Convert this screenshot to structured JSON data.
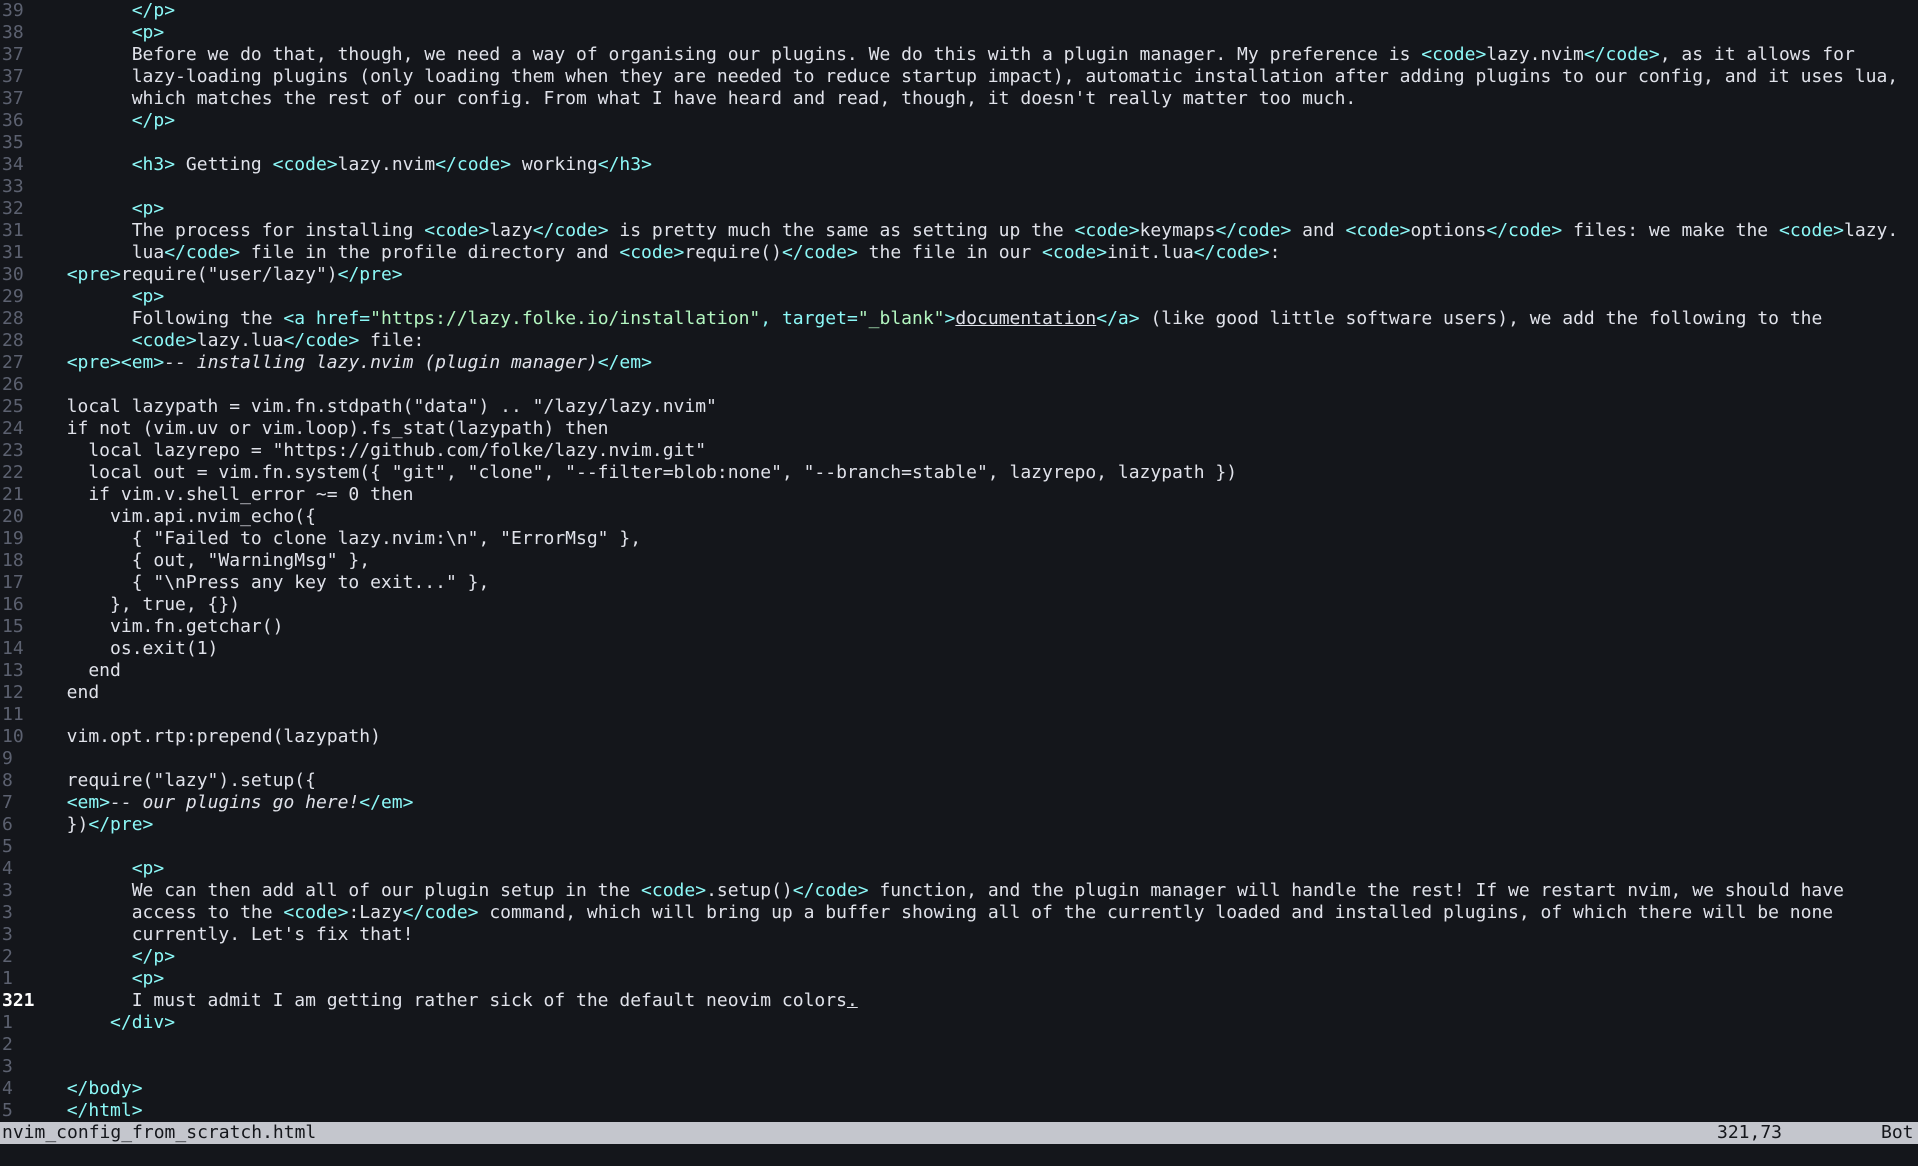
{
  "statusline": {
    "filename": "nvim_config_from_scratch.html",
    "position": "321,73",
    "scroll": "Bot"
  },
  "colors": {
    "background": "#14161b",
    "text": "#e0e2ea",
    "tag": "#8cf8f7",
    "string": "#b3f6c0",
    "line_number": "#5c6170",
    "statusline_bg": "#c4c6cd"
  },
  "lines": [
    {
      "num": "39",
      "segs": [
        [
          "",
          "        "
        ],
        [
          "tag",
          "</p>"
        ]
      ]
    },
    {
      "num": "38",
      "segs": [
        [
          "",
          "        "
        ],
        [
          "tag",
          "<p>"
        ]
      ]
    },
    {
      "num": "37",
      "segs": [
        [
          "",
          "        Before we do that, though, we need a way of organising our plugins. We do this with a plugin manager. My preference is "
        ],
        [
          "tag",
          "<code>"
        ],
        [
          "",
          "lazy.nvim"
        ],
        [
          "tag",
          "</code>"
        ],
        [
          "",
          ", as it allows for"
        ]
      ]
    },
    {
      "num": "37",
      "segs": [
        [
          "",
          "        lazy-loading plugins (only loading them when they are needed to reduce startup impact), automatic installation after adding plugins to our config, and it uses lua,"
        ]
      ]
    },
    {
      "num": "37",
      "segs": [
        [
          "",
          "        which matches the rest of our config. From what I have heard and read, though, it doesn't really matter too much."
        ]
      ]
    },
    {
      "num": "36",
      "segs": [
        [
          "",
          "        "
        ],
        [
          "tag",
          "</p>"
        ]
      ]
    },
    {
      "num": "35",
      "segs": []
    },
    {
      "num": "34",
      "segs": [
        [
          "",
          "        "
        ],
        [
          "tag",
          "<h3>"
        ],
        [
          "",
          " Getting "
        ],
        [
          "tag",
          "<code>"
        ],
        [
          "",
          "lazy.nvim"
        ],
        [
          "tag",
          "</code>"
        ],
        [
          "",
          " working"
        ],
        [
          "tag",
          "</h3>"
        ]
      ]
    },
    {
      "num": "33",
      "segs": []
    },
    {
      "num": "32",
      "segs": [
        [
          "",
          "        "
        ],
        [
          "tag",
          "<p>"
        ]
      ]
    },
    {
      "num": "31",
      "segs": [
        [
          "",
          "        The process for installing "
        ],
        [
          "tag",
          "<code>"
        ],
        [
          "",
          "lazy"
        ],
        [
          "tag",
          "</code>"
        ],
        [
          "",
          " is pretty much the same as setting up the "
        ],
        [
          "tag",
          "<code>"
        ],
        [
          "",
          "keymaps"
        ],
        [
          "tag",
          "</code>"
        ],
        [
          "",
          " and "
        ],
        [
          "tag",
          "<code>"
        ],
        [
          "",
          "options"
        ],
        [
          "tag",
          "</code>"
        ],
        [
          "",
          " files: we make the "
        ],
        [
          "tag",
          "<code>"
        ],
        [
          "",
          "lazy."
        ]
      ]
    },
    {
      "num": "31",
      "segs": [
        [
          "",
          "        lua"
        ],
        [
          "tag",
          "</code>"
        ],
        [
          "",
          " file in the profile directory and "
        ],
        [
          "tag",
          "<code>"
        ],
        [
          "",
          "require()"
        ],
        [
          "tag",
          "</code>"
        ],
        [
          "",
          " the file in our "
        ],
        [
          "tag",
          "<code>"
        ],
        [
          "",
          "init.lua"
        ],
        [
          "tag",
          "</code>"
        ],
        [
          "",
          ":"
        ]
      ]
    },
    {
      "num": "30",
      "segs": [
        [
          "",
          "  "
        ],
        [
          "tag",
          "<pre>"
        ],
        [
          "",
          "require(\"user/lazy\")"
        ],
        [
          "tag",
          "</pre>"
        ]
      ]
    },
    {
      "num": "29",
      "segs": [
        [
          "",
          "        "
        ],
        [
          "tag",
          "<p>"
        ]
      ]
    },
    {
      "num": "28",
      "segs": [
        [
          "",
          "        Following the "
        ],
        [
          "tag",
          "<a href="
        ],
        [
          "str",
          "\"https://lazy.folke.io/installation\""
        ],
        [
          "tag",
          ", target="
        ],
        [
          "str",
          "\"_blank\""
        ],
        [
          "tag",
          ">"
        ],
        [
          "u",
          "documentation"
        ],
        [
          "tag",
          "</a>"
        ],
        [
          "",
          " (like good little software users), we add the following to the"
        ]
      ]
    },
    {
      "num": "28",
      "segs": [
        [
          "",
          "        "
        ],
        [
          "tag",
          "<code>"
        ],
        [
          "",
          "lazy.lua"
        ],
        [
          "tag",
          "</code>"
        ],
        [
          "",
          " file:"
        ]
      ]
    },
    {
      "num": "27",
      "segs": [
        [
          "",
          "  "
        ],
        [
          "tag",
          "<pre><em>"
        ],
        [
          "em",
          "-- installing lazy.nvim (plugin manager)"
        ],
        [
          "tag",
          "</em>"
        ]
      ]
    },
    {
      "num": "26",
      "segs": []
    },
    {
      "num": "25",
      "segs": [
        [
          "",
          "  local lazypath = vim.fn.stdpath(\"data\") .. \"/lazy/lazy.nvim\""
        ]
      ]
    },
    {
      "num": "24",
      "segs": [
        [
          "",
          "  if not (vim.uv or vim.loop).fs_stat(lazypath) then"
        ]
      ]
    },
    {
      "num": "23",
      "segs": [
        [
          "",
          "    local lazyrepo = \"https://github.com/folke/lazy.nvim.git\""
        ]
      ]
    },
    {
      "num": "22",
      "segs": [
        [
          "",
          "    local out = vim.fn.system({ \"git\", \"clone\", \"--filter=blob:none\", \"--branch=stable\", lazyrepo, lazypath })"
        ]
      ]
    },
    {
      "num": "21",
      "segs": [
        [
          "",
          "    if vim.v.shell_error ~= 0 then"
        ]
      ]
    },
    {
      "num": "20",
      "segs": [
        [
          "",
          "      vim.api.nvim_echo({"
        ]
      ]
    },
    {
      "num": "19",
      "segs": [
        [
          "",
          "        { \"Failed to clone lazy.nvim:\\n\", \"ErrorMsg\" },"
        ]
      ]
    },
    {
      "num": "18",
      "segs": [
        [
          "",
          "        { out, \"WarningMsg\" },"
        ]
      ]
    },
    {
      "num": "17",
      "segs": [
        [
          "",
          "        { \"\\nPress any key to exit...\" },"
        ]
      ]
    },
    {
      "num": "16",
      "segs": [
        [
          "",
          "      }, true, {})"
        ]
      ]
    },
    {
      "num": "15",
      "segs": [
        [
          "",
          "      vim.fn.getchar()"
        ]
      ]
    },
    {
      "num": "14",
      "segs": [
        [
          "",
          "      os.exit(1)"
        ]
      ]
    },
    {
      "num": "13",
      "segs": [
        [
          "",
          "    end"
        ]
      ]
    },
    {
      "num": "12",
      "segs": [
        [
          "",
          "  end"
        ]
      ]
    },
    {
      "num": "11",
      "segs": []
    },
    {
      "num": "10",
      "segs": [
        [
          "",
          "  vim.opt.rtp:prepend(lazypath)"
        ]
      ]
    },
    {
      "num": "9",
      "segs": []
    },
    {
      "num": "8",
      "segs": [
        [
          "",
          "  require(\"lazy\").setup({"
        ]
      ]
    },
    {
      "num": "7",
      "segs": [
        [
          "",
          "  "
        ],
        [
          "tag",
          "<em>"
        ],
        [
          "em",
          "-- our plugins go here!"
        ],
        [
          "tag",
          "</em>"
        ]
      ]
    },
    {
      "num": "6",
      "segs": [
        [
          "",
          "  })"
        ],
        [
          "tag",
          "</pre>"
        ]
      ]
    },
    {
      "num": "5",
      "segs": []
    },
    {
      "num": "4",
      "segs": [
        [
          "",
          "        "
        ],
        [
          "tag",
          "<p>"
        ]
      ]
    },
    {
      "num": "3",
      "segs": [
        [
          "",
          "        We can then add all of our plugin setup in the "
        ],
        [
          "tag",
          "<code>"
        ],
        [
          "",
          ".setup()"
        ],
        [
          "tag",
          "</code>"
        ],
        [
          "",
          " function, and the plugin manager will handle the rest! If we restart nvim, we should have"
        ]
      ]
    },
    {
      "num": "3",
      "segs": [
        [
          "",
          "        access to the "
        ],
        [
          "tag",
          "<code>"
        ],
        [
          "",
          ":Lazy"
        ],
        [
          "tag",
          "</code>"
        ],
        [
          "",
          " command, which will bring up a buffer showing all of the currently loaded and installed plugins, of which there will be none"
        ]
      ]
    },
    {
      "num": "3",
      "segs": [
        [
          "",
          "        currently. Let's fix that!"
        ]
      ]
    },
    {
      "num": "2",
      "segs": [
        [
          "",
          "        "
        ],
        [
          "tag",
          "</p>"
        ]
      ]
    },
    {
      "num": "1",
      "segs": [
        [
          "",
          "        "
        ],
        [
          "tag",
          "<p>"
        ]
      ]
    },
    {
      "num": "321",
      "current": true,
      "segs": [
        [
          "",
          "        I must admit I am getting rather sick of the default neovim colors"
        ],
        [
          "cur",
          "."
        ]
      ]
    },
    {
      "num": "1",
      "segs": [
        [
          "",
          "      "
        ],
        [
          "tag",
          "</div>"
        ]
      ]
    },
    {
      "num": "2",
      "segs": []
    },
    {
      "num": "3",
      "segs": []
    },
    {
      "num": "4",
      "segs": [
        [
          "",
          "  "
        ],
        [
          "tag",
          "</body>"
        ]
      ]
    },
    {
      "num": "5",
      "segs": [
        [
          "",
          "  "
        ],
        [
          "tag",
          "</html>"
        ]
      ]
    }
  ]
}
